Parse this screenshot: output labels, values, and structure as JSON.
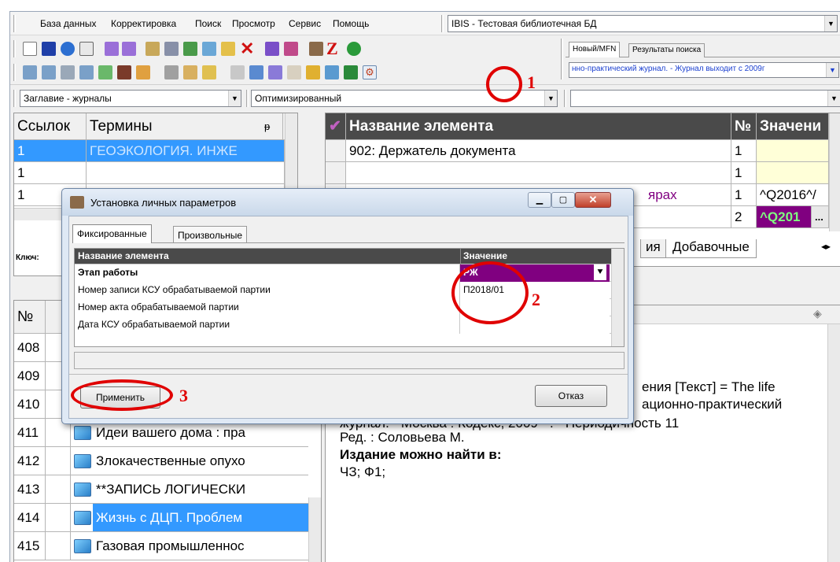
{
  "menu": {
    "items": [
      "База данных",
      "Корректировка",
      "Поиск",
      "Просмотр",
      "Сервис",
      "Помощь"
    ]
  },
  "db_combo": {
    "value": "IBIS - Тестовая библиотечная БД"
  },
  "right_tabs": {
    "tab1": "Новый/MFN",
    "tab2": "Результаты поиска"
  },
  "search_result_combo": {
    "value": "нно-практический журнал. - Журнал выходит с 2009г"
  },
  "filter_bar": {
    "dictionary": "Заглавие - журналы",
    "mode": "Оптимизированный",
    "extra": ""
  },
  "terms_panel": {
    "headers": {
      "links": "Ссылок",
      "terms": "Термины"
    },
    "rows": [
      {
        "links": "1",
        "term": "ГЕОЭКОЛОГИЯ. ИНЖЕ"
      },
      {
        "links": "1",
        "term": ""
      },
      {
        "links": "1",
        "term": ""
      }
    ],
    "key_label": "Ключ:"
  },
  "elements_panel": {
    "headers": {
      "name": "Название элемента",
      "num": "№",
      "value": "Значени"
    },
    "rows": [
      {
        "name": "902: Держатель документа",
        "num": "1",
        "value": ""
      },
      {
        "name": "",
        "num": "1",
        "value": ""
      },
      {
        "name": "ярах",
        "num": "1",
        "value": "^Q2016^/"
      },
      {
        "name": "",
        "num": "2",
        "value": "^Q201"
      }
    ],
    "tabs_partial": "ия",
    "tab_extra": "Добавочные"
  },
  "records_panel": {
    "header": "№",
    "rows": [
      {
        "num": "408",
        "title": ""
      },
      {
        "num": "409",
        "title": ""
      },
      {
        "num": "410",
        "title": ""
      },
      {
        "num": "411",
        "title": "Идеи вашего дома : пра"
      },
      {
        "num": "412",
        "title": "Злокачественные опухо"
      },
      {
        "num": "413",
        "title": "**ЗАПИСЬ ЛОГИЧЕСКИ"
      },
      {
        "num": "414",
        "title": "Жизнь с ДЦП. Проблем"
      },
      {
        "num": "415",
        "title": "Газовая промышленнос"
      }
    ]
  },
  "description": {
    "line1": "ения [Текст] = The life",
    "line2": "ационно-практический",
    "line3": "журнал. - Москва : Кодекс, 2009 - . - Периодичность 11",
    "line4": "Ред. : Соловьева М.",
    "line5": "Издание можно найти в:",
    "line6": "ЧЗ; Ф1;"
  },
  "dialog": {
    "title": "Установка личных параметров",
    "tabs": [
      "Фиксированные",
      "Произвольные"
    ],
    "columns": {
      "name": "Название элемента",
      "value": "Значение"
    },
    "rows": [
      {
        "name": "Этап работы",
        "value": "РЖ"
      },
      {
        "name": "Номер записи КСУ обрабатываемой партии",
        "value": "П2018/01"
      },
      {
        "name": "Номер акта обрабатываемой партии",
        "value": ""
      },
      {
        "name": "Дата КСУ обрабатываемой партии",
        "value": ""
      }
    ],
    "apply_label": "Применить",
    "cancel_label": "Отказ"
  },
  "annotations": {
    "one": "1",
    "two": "2",
    "three": "3"
  },
  "colors": {
    "selection_blue": "#3399ff",
    "purple": "#800080",
    "annotation_red": "#e00000"
  }
}
